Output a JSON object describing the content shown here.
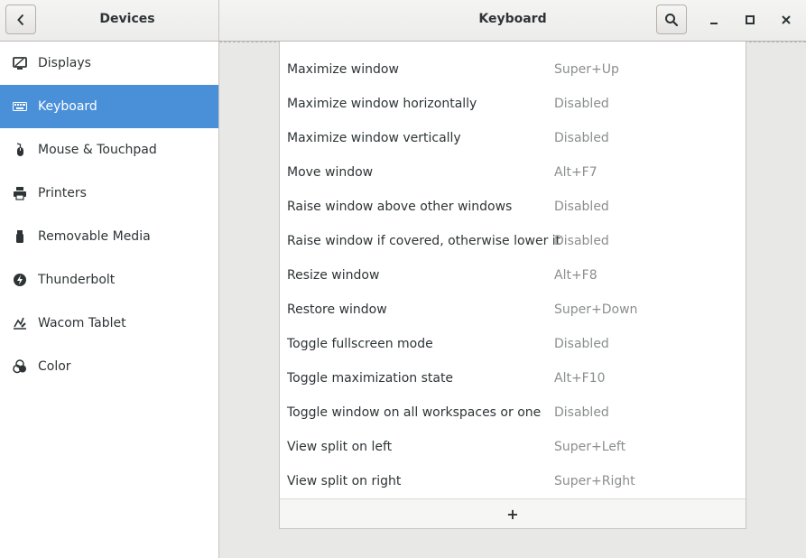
{
  "header": {
    "left_title": "Devices",
    "main_title": "Keyboard"
  },
  "sidebar": {
    "items": [
      {
        "label": "Displays",
        "icon": "display-icon",
        "selected": false
      },
      {
        "label": "Keyboard",
        "icon": "keyboard-icon",
        "selected": true
      },
      {
        "label": "Mouse & Touchpad",
        "icon": "mouse-icon",
        "selected": false
      },
      {
        "label": "Printers",
        "icon": "printer-icon",
        "selected": false
      },
      {
        "label": "Removable Media",
        "icon": "removable-media-icon",
        "selected": false
      },
      {
        "label": "Thunderbolt",
        "icon": "thunderbolt-icon",
        "selected": false
      },
      {
        "label": "Wacom Tablet",
        "icon": "tablet-icon",
        "selected": false
      },
      {
        "label": "Color",
        "icon": "color-icon",
        "selected": false
      }
    ]
  },
  "shortcuts": [
    {
      "name": "Maximize window",
      "accel": "Super+Up"
    },
    {
      "name": "Maximize window horizontally",
      "accel": "Disabled"
    },
    {
      "name": "Maximize window vertically",
      "accel": "Disabled"
    },
    {
      "name": "Move window",
      "accel": "Alt+F7"
    },
    {
      "name": "Raise window above other windows",
      "accel": "Disabled"
    },
    {
      "name": "Raise window if covered, otherwise lower it",
      "accel": "Disabled"
    },
    {
      "name": "Resize window",
      "accel": "Alt+F8"
    },
    {
      "name": "Restore window",
      "accel": "Super+Down"
    },
    {
      "name": "Toggle fullscreen mode",
      "accel": "Disabled"
    },
    {
      "name": "Toggle maximization state",
      "accel": "Alt+F10"
    },
    {
      "name": "Toggle window on all workspaces or one",
      "accel": "Disabled"
    },
    {
      "name": "View split on left",
      "accel": "Super+Left"
    },
    {
      "name": "View split on right",
      "accel": "Super+Right"
    }
  ],
  "add_button": {
    "label": "+"
  },
  "colors": {
    "selection": "#4a90d9",
    "accel_text": "#8b8e8f"
  }
}
